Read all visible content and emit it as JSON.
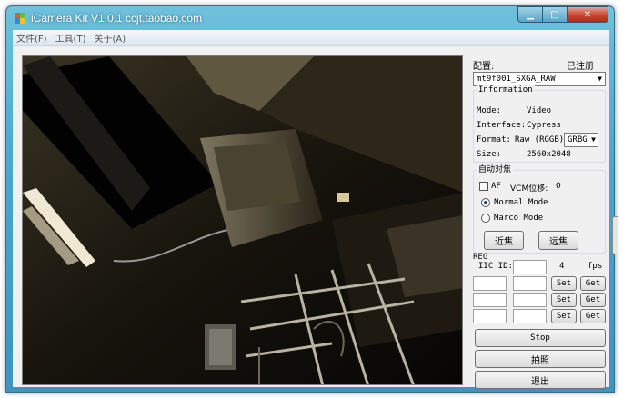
{
  "window": {
    "title": "iCamera Kit V1.0.1  ccjt.taobao.com",
    "min_label": "▁",
    "max_label": "□",
    "close_label": "✕"
  },
  "menu": [
    "文件(F)",
    "工具(T)",
    "关于(A)"
  ],
  "config": {
    "label": "配置:",
    "registered": "已注册",
    "selected": "mt9f001_SXGA_RAW"
  },
  "information": {
    "title": "Information",
    "mode_label": "Mode:",
    "mode_value": "Video",
    "interface_label": "Interface:",
    "interface_value": "Cypress",
    "format_label": "Format:",
    "format_value": "Raw (RGGB)",
    "bayer_selected": "GRBG",
    "size_label": "Size:",
    "size_value": "2560x2048"
  },
  "autofocus": {
    "title": "自动对焦",
    "af_label": "AF",
    "af_checked": false,
    "vcm_label": "VCM位移:",
    "vcm_value": "0",
    "normal_mode": "Normal Mode",
    "macro_mode": "Marco Mode",
    "selected_mode": "normal",
    "near_button": "近焦",
    "far_button": "远焦"
  },
  "reg": {
    "title": "REG",
    "iic_label": "IIC ID:",
    "fps_value": "4",
    "fps_label": "fps",
    "set_label": "Set",
    "get_label": "Get"
  },
  "actions": {
    "stop": "Stop",
    "capture": "拍照",
    "exit": "退出"
  }
}
